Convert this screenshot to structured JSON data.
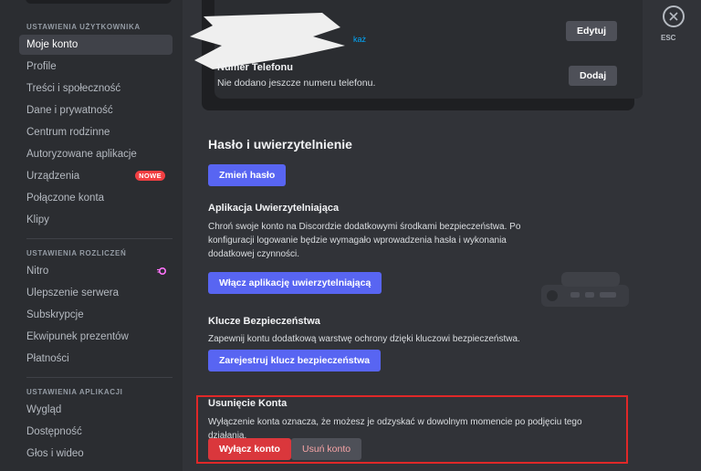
{
  "sidebar": {
    "sections": [
      {
        "header": "USTAWIENIA UŻYTKOWNIKA",
        "items": [
          {
            "label": "Moje konto"
          },
          {
            "label": "Profile"
          },
          {
            "label": "Treści i społeczność"
          },
          {
            "label": "Dane i prywatność"
          },
          {
            "label": "Centrum rodzinne"
          },
          {
            "label": "Autoryzowane aplikacje"
          },
          {
            "label": "Urządzenia",
            "badge": "NOWE"
          },
          {
            "label": "Połączone konta"
          },
          {
            "label": "Klipy"
          }
        ]
      },
      {
        "header": "USTAWIENIA ROZLICZEŃ",
        "items": [
          {
            "label": "Nitro",
            "icon": "nitro-icon"
          },
          {
            "label": "Ulepszenie serwera"
          },
          {
            "label": "Subskrypcje"
          },
          {
            "label": "Ekwipunek prezentów"
          },
          {
            "label": "Płatności"
          }
        ]
      },
      {
        "header": "USTAWIENIA APLIKACJI",
        "items": [
          {
            "label": "Wygląd"
          },
          {
            "label": "Dostępność"
          },
          {
            "label": "Głos i wideo"
          }
        ]
      }
    ],
    "active_item": "Moje konto"
  },
  "account_card": {
    "email_reveal_link": "każ",
    "edit_button": "Edytuj",
    "phone_label": "Numer Telefonu",
    "phone_value": "Nie dodano jeszcze numeru telefonu.",
    "add_button": "Dodaj"
  },
  "security": {
    "title": "Hasło i uwierzytelnienie",
    "change_password_button": "Zmień hasło",
    "auth_app": {
      "title": "Aplikacja Uwierzytelniająca",
      "description": "Chroń swoje konto na Discordzie dodatkowymi środkami bezpieczeństwa. Po konfiguracji logowanie będzie wymagało wprowadzenia hasła i wykonania dodatkowej czynności.",
      "button": "Włącz aplikację uwierzytelniającą"
    },
    "security_keys": {
      "title": "Klucze Bezpieczeństwa",
      "description": "Zapewnij kontu dodatkową warstwę ochrony dzięki kluczowi bezpieczeństwa.",
      "button": "Zarejestruj klucz bezpieczeństwa"
    }
  },
  "account_removal": {
    "title": "Usunięcie Konta",
    "description": "Wyłączenie konta oznacza, że możesz je odzyskać w dowolnym momencie po podjęciu tego działania.",
    "disable_button": "Wyłącz konto",
    "delete_button": "Usuń konto"
  },
  "close": {
    "label": "ESC",
    "icon": "close-icon"
  },
  "colors": {
    "accent": "#5865f2",
    "danger": "#da373c",
    "badge": "#f23f42",
    "highlight": "#e02828"
  }
}
